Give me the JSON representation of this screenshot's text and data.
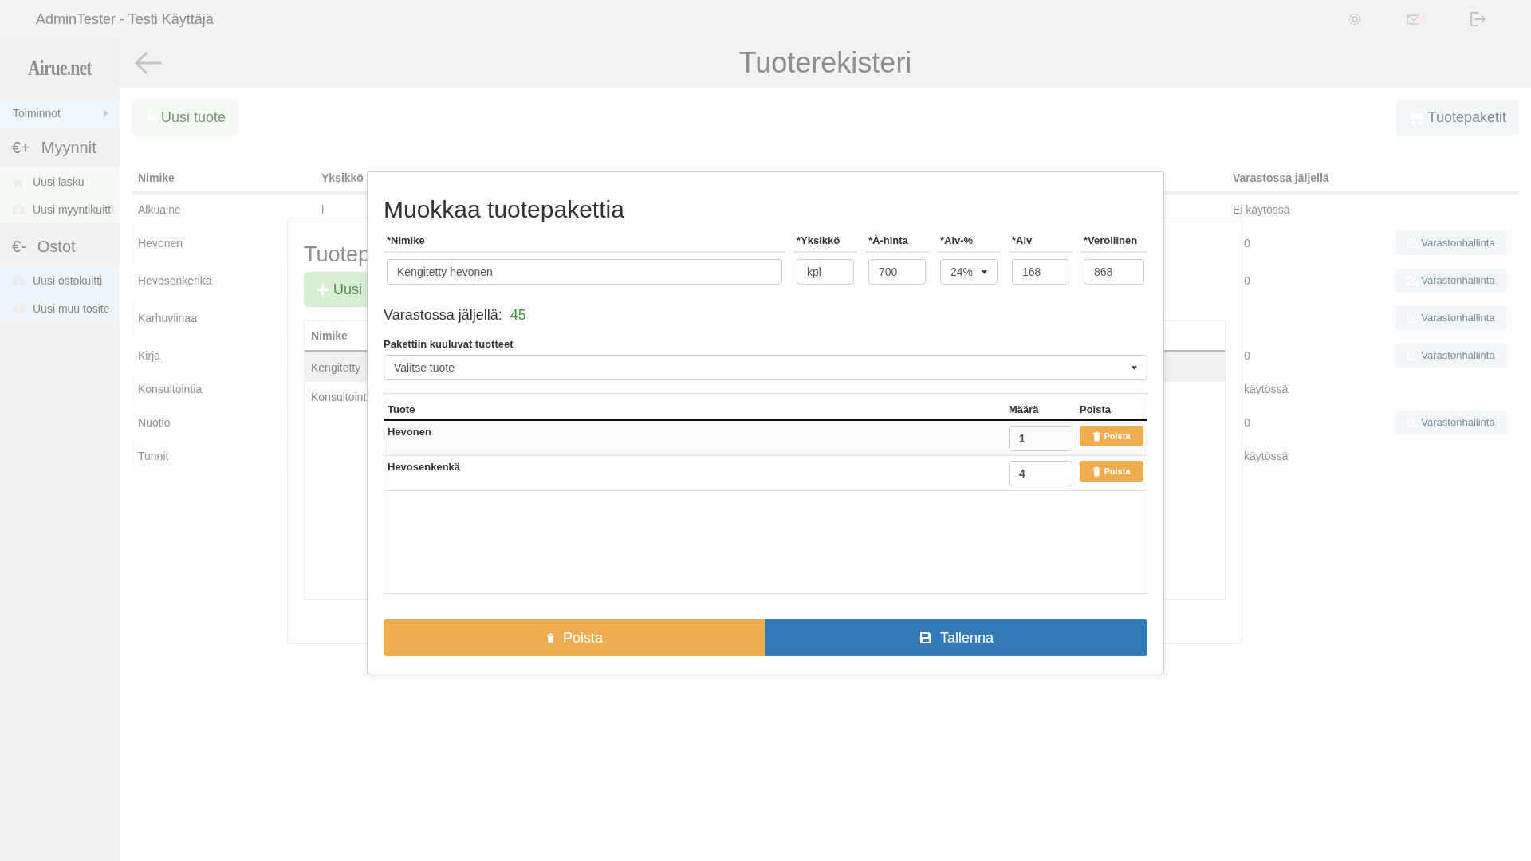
{
  "header": {
    "user": "AdminTester - Testi Käyttäjä",
    "logo": "Airue.net",
    "title": "Tuoterekisteri"
  },
  "sidebar": {
    "menu_toggle": "Toiminnot",
    "sections": [
      {
        "kind": "sales",
        "sign": "€+",
        "title": "Myynnit",
        "items": [
          {
            "label": "Uusi lasku",
            "kind": "piggy"
          },
          {
            "label": "Uusi myyntikuitti",
            "kind": "camera"
          }
        ]
      },
      {
        "kind": "purchases",
        "sign": "€-",
        "title": "Ostot",
        "items": [
          {
            "label": "Uusi ostokuitti",
            "kind": "camera"
          },
          {
            "label": "Uusi muu tosite",
            "kind": "camera"
          }
        ]
      }
    ]
  },
  "toolbar": {
    "new_product": "Uusi tuote",
    "packages": "Tuotepaketit"
  },
  "product_table": {
    "columns": [
      "Nimike",
      "Yksikkö",
      "Varastossa jäljellä"
    ],
    "rows": [
      {
        "name": "Alkuaine",
        "unit": "l",
        "stock": "Ei käytössä"
      },
      {
        "name": "Hevonen",
        "stock": "0",
        "action": "Varastonhallinta"
      },
      {
        "name": "Hevosenkenkä",
        "stock": "0",
        "action": "Varastonhallinta"
      },
      {
        "name": "Karhuviinaa",
        "action": "Varastonhallinta"
      },
      {
        "name": "Kirja",
        "stock": "0",
        "action": "Varastonhallinta"
      },
      {
        "name": "Konsultointia",
        "stock": "käytössä"
      },
      {
        "name": "Nuotio",
        "stock": "0",
        "action": "Varastonhallinta"
      },
      {
        "name": "Tunnit",
        "stock": "käytössä"
      }
    ]
  },
  "packages_panel": {
    "title": "Tuotep",
    "new_button": "Uusi",
    "column": "Nimike",
    "rows": [
      {
        "name": "Kengitetty",
        "selected": true
      },
      {
        "name": "Konsultoint",
        "selected": false
      }
    ]
  },
  "edit_modal": {
    "title": "Muokkaa tuotepakettia",
    "fields": [
      {
        "label": "*Nimike",
        "value": "Kengitetty hevonen",
        "kind": "text"
      },
      {
        "label": "*Yksikkö",
        "value": "kpl",
        "kind": "text"
      },
      {
        "label": "*À-hinta",
        "value": "700",
        "kind": "text"
      },
      {
        "label": "*Alv-%",
        "value": "24%",
        "kind": "select"
      },
      {
        "label": "*Alv",
        "value": "168",
        "kind": "text"
      },
      {
        "label": "*Verollinen",
        "value": "868",
        "kind": "text"
      }
    ],
    "stock_label": "Varastossa jäljellä:",
    "stock_value": "45",
    "package_label": "Pakettiin kuuluvat tuotteet",
    "product_select": "Valitse tuote",
    "items_table": {
      "columns": [
        "Tuote",
        "Määrä",
        "Poista"
      ],
      "rows": [
        {
          "name": "Hevonen",
          "quantity": "1",
          "remove": "Poista"
        },
        {
          "name": "Hevosenkenkä",
          "quantity": "4",
          "remove": "Poista"
        }
      ]
    },
    "buttons": [
      {
        "kind": "delete",
        "label": "Poista"
      },
      {
        "kind": "save",
        "label": "Tallenna"
      }
    ]
  }
}
